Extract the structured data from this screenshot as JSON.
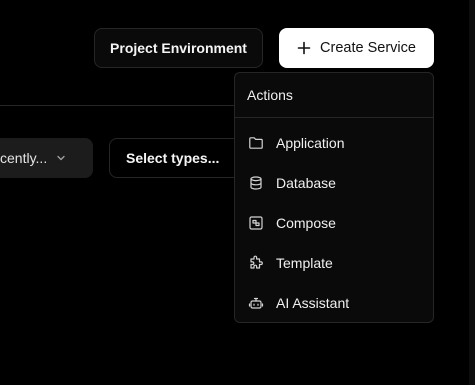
{
  "header": {
    "project_environment_label": "Project Environment",
    "create_service_label": "Create Service"
  },
  "filters": {
    "sort_value": "cently...",
    "types_placeholder": "Select types..."
  },
  "actions_menu": {
    "title": "Actions",
    "items": [
      {
        "label": "Application",
        "icon": "folder-icon"
      },
      {
        "label": "Database",
        "icon": "database-icon"
      },
      {
        "label": "Compose",
        "icon": "compose-icon"
      },
      {
        "label": "Template",
        "icon": "puzzle-icon"
      },
      {
        "label": "AI Assistant",
        "icon": "bot-icon"
      }
    ]
  },
  "colors": {
    "background": "#000000",
    "primary_button": "#ffffff",
    "border": "#262626"
  }
}
